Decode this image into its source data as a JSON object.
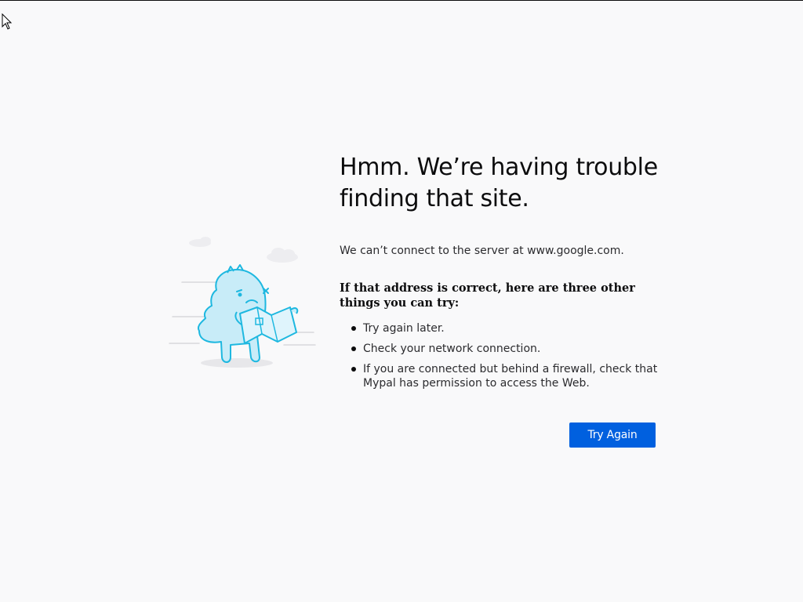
{
  "error_page": {
    "title": "Hmm. We’re having trouble finding that site.",
    "description": "We can’t connect to the server at www.google.com.",
    "suggestions_heading": "If that address is correct, here are three other things you can try:",
    "suggestions": [
      "Try again later.",
      "Check your network connection.",
      "If you are connected but behind a firewall, check that Mypal has permission to access the Web."
    ],
    "try_again_label": "Try Again"
  },
  "icons": {
    "illustration": "confused-monster-with-map-illustration",
    "cursor": "mouse-pointer-icon"
  },
  "colors": {
    "background": "#f9f9fa",
    "button": "#0060df",
    "illustration_stroke": "#1eb8e0",
    "illustration_fill": "#c8ecf8"
  }
}
